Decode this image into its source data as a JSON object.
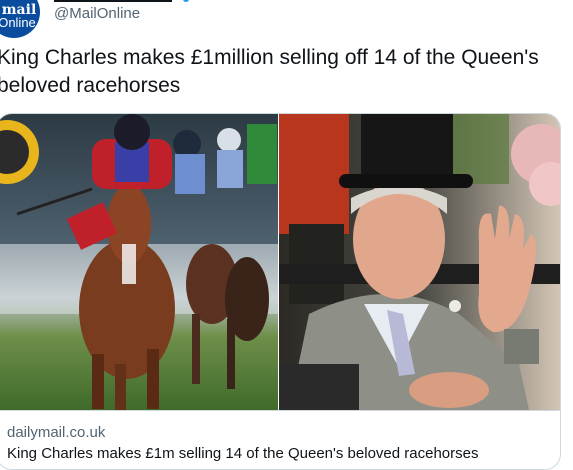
{
  "author": {
    "avatar_text_line1": "mail",
    "avatar_text_line2": "Online",
    "handle": "@MailOnline",
    "avatar_color": "#0a4d9e",
    "verified_color": "#1d9bf0"
  },
  "tweet": {
    "text": "King Charles makes £1million selling off 14 of the Queen's beloved racehorses"
  },
  "card": {
    "domain": "dailymail.co.uk",
    "title": "King Charles makes £1m selling 14 of the Queen's beloved racehorses",
    "images": [
      {
        "description": "racehorses-photo"
      },
      {
        "description": "king-charles-photo"
      }
    ]
  }
}
